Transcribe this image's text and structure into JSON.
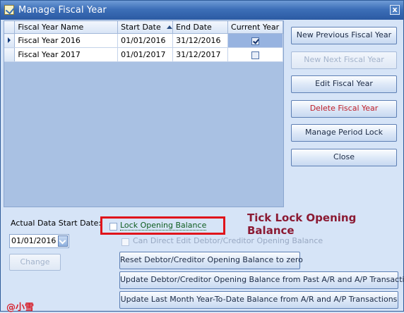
{
  "window": {
    "title": "Manage Fiscal Year",
    "close_glyph": "x"
  },
  "grid": {
    "columns": [
      "Fiscal Year Name",
      "Start Date",
      "End Date",
      "Current Year"
    ],
    "sort_column": "Start Date",
    "rows": [
      {
        "name": "Fiscal Year 2016",
        "start": "01/01/2016",
        "end": "31/12/2016",
        "current": true,
        "selected": true
      },
      {
        "name": "Fiscal Year 2017",
        "start": "01/01/2017",
        "end": "31/12/2017",
        "current": false,
        "selected": false
      }
    ]
  },
  "buttons": {
    "new_previous": "New Previous Fiscal Year",
    "new_next": "New Next Fiscal Year",
    "edit": "Edit Fiscal Year",
    "delete": "Delete Fiscal Year",
    "manage_period_lock": "Manage Period Lock",
    "close": "Close",
    "change": "Change",
    "reset_opening": "Reset Debtor/Creditor Opening Balance to zero",
    "update_opening": "Update Debtor/Creditor Opening Balance from Past A/R and A/P Transactions",
    "update_ytd": "Update Last Month Year-To-Date Balance from A/R and A/P Transactions"
  },
  "actual_start": {
    "label": "Actual Data Start Date:",
    "value": "01/01/2016"
  },
  "options": {
    "lock_opening_balance": "Lock Opening Balance",
    "can_direct_edit": "Can Direct Edit Debtor/Creditor Opening Balance"
  },
  "annotation": {
    "line1": "Tick Lock Opening",
    "line2": "Balance"
  },
  "watermark": "@小雪",
  "colors": {
    "titlebar": "#3d6fb8",
    "highlight": "#e0141b",
    "annotation": "#8b1a33",
    "danger": "#c0202a"
  }
}
